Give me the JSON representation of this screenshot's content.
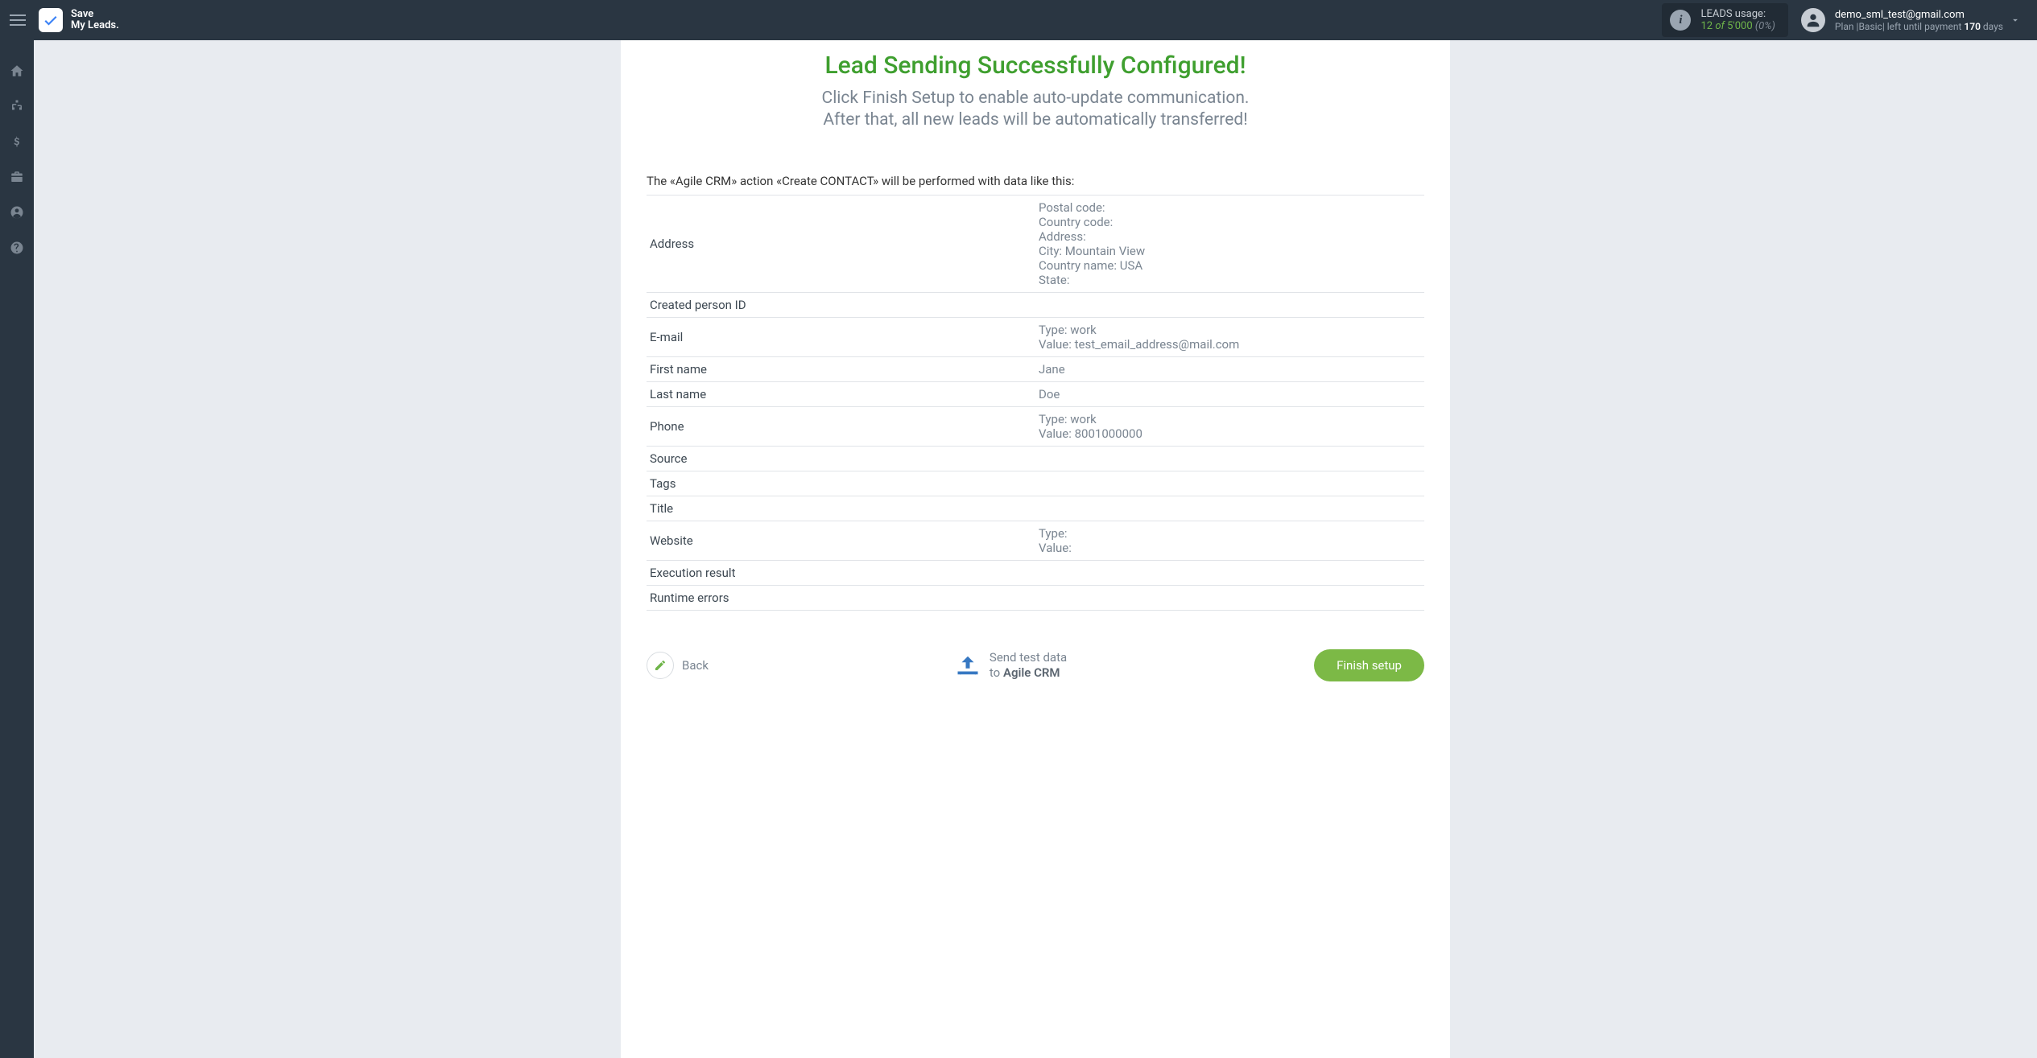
{
  "brand": {
    "line1": "Save",
    "line2": "My Leads."
  },
  "usage": {
    "label": "LEADS usage:",
    "count": "12",
    "of": "of",
    "total": "5'000",
    "pct": "(0%)"
  },
  "user": {
    "email": "demo_sml_test@gmail.com",
    "plan_prefix": "Plan |Basic| left until payment ",
    "days": "170",
    "days_suffix": " days"
  },
  "page": {
    "heading": "Lead Sending Successfully Configured!",
    "sub_line1": "Click Finish Setup to enable auto-update communication.",
    "sub_line2": "After that, all new leads will be automatically transferred!",
    "action_label": "The «Agile CRM» action «Create CONTACT» will be performed with data like this:"
  },
  "rows": {
    "address_key": "Address",
    "address_val": "Postal code:\nCountry code:\nAddress:\nCity: Mountain View\nCountry name: USA\nState:",
    "created_key": "Created person ID",
    "created_val": "",
    "email_key": "E-mail",
    "email_val": "Type: work\nValue: test_email_address@mail.com",
    "firstname_key": "First name",
    "firstname_val": "Jane",
    "lastname_key": "Last name",
    "lastname_val": "Doe",
    "phone_key": "Phone",
    "phone_val": "Type: work\nValue: 8001000000",
    "source_key": "Source",
    "source_val": "",
    "tags_key": "Tags",
    "tags_val": "",
    "title_key": "Title",
    "title_val": "",
    "website_key": "Website",
    "website_val": "Type:\nValue:",
    "exec_key": "Execution result",
    "exec_val": "",
    "runtime_key": "Runtime errors",
    "runtime_val": ""
  },
  "footer": {
    "back": "Back",
    "send_line1": "Send test data",
    "send_line2_prefix": "to ",
    "send_line2_bold": "Agile CRM",
    "finish": "Finish setup"
  }
}
